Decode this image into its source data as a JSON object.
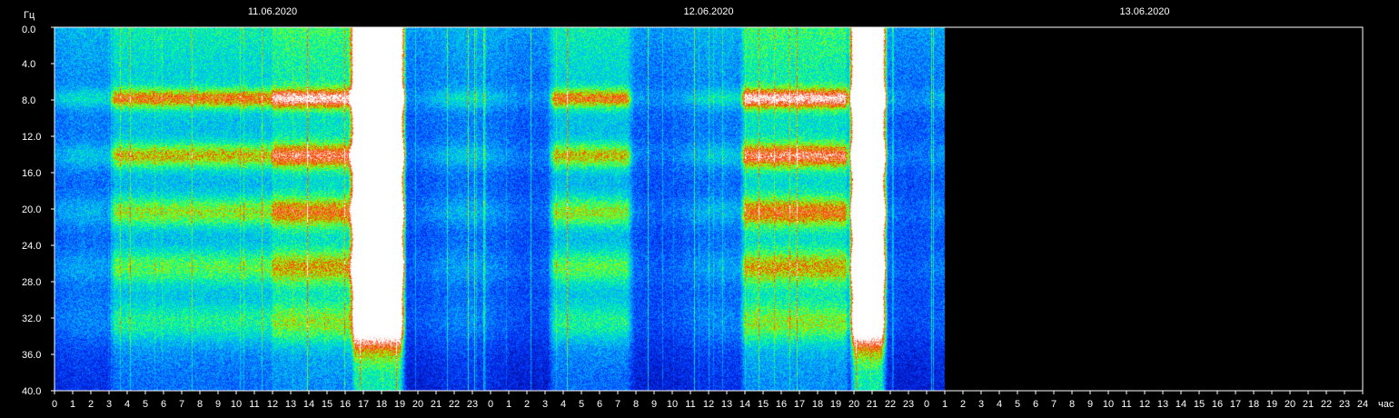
{
  "chart_data": {
    "type": "heatmap",
    "title": "",
    "ylabel": "Гц",
    "xlabel": "час",
    "ylim": [
      0,
      40
    ],
    "y_ticks": [
      "0.0",
      "4.0",
      "8.0",
      "12.0",
      "16.0",
      "20.0",
      "24.0",
      "28.0",
      "32.0",
      "36.0",
      "40.0"
    ],
    "x_tick_labels": [
      "0",
      "1",
      "2",
      "3",
      "4",
      "5",
      "6",
      "7",
      "8",
      "9",
      "10",
      "11",
      "12",
      "13",
      "14",
      "15",
      "16",
      "17",
      "18",
      "19",
      "20",
      "21",
      "22",
      "23",
      "0",
      "1",
      "2",
      "3",
      "4",
      "5",
      "6",
      "7",
      "8",
      "9",
      "10",
      "11",
      "12",
      "13",
      "14",
      "15",
      "16",
      "17",
      "18",
      "19",
      "20",
      "21",
      "22",
      "23",
      "0",
      "1",
      "2",
      "3",
      "4",
      "5",
      "6",
      "7",
      "8",
      "9",
      "10",
      "11",
      "12",
      "13",
      "14",
      "15",
      "16",
      "17",
      "18",
      "19",
      "20",
      "21",
      "22",
      "23",
      "24"
    ],
    "dates": [
      {
        "label": "11.06.2020",
        "start_hour": 0
      },
      {
        "label": "12.06.2020",
        "start_hour": 24
      },
      {
        "label": "13.06.2020",
        "start_hour": 48
      }
    ],
    "total_hours": 72,
    "data_end_hour": 49,
    "resonance_bands_hz": [
      7.8,
      14.1,
      20.3,
      26.4,
      32.5
    ],
    "bursts": [
      {
        "from_hour": 3.3,
        "to_hour": 7.2,
        "intensity": "high"
      },
      {
        "from_hour": 7.0,
        "to_hour": 12.0,
        "intensity": "high"
      },
      {
        "from_hour": 12.0,
        "to_hour": 16.5,
        "intensity": "very high"
      },
      {
        "from_hour": 16.5,
        "to_hour": 19.0,
        "intensity": "saturated"
      },
      {
        "from_hour": 27.5,
        "to_hour": 31.5,
        "intensity": "high"
      },
      {
        "from_hour": 38.0,
        "to_hour": 43.5,
        "intensity": "very high"
      },
      {
        "from_hour": 44.0,
        "to_hour": 45.5,
        "intensity": "saturated"
      }
    ],
    "colors": {
      "background": "#000000",
      "axis": "#ffffff",
      "colormap": [
        "#00007a",
        "#0033ff",
        "#00b4ff",
        "#00ff9c",
        "#a0ff00",
        "#ff3000",
        "#ffffff"
      ]
    }
  }
}
